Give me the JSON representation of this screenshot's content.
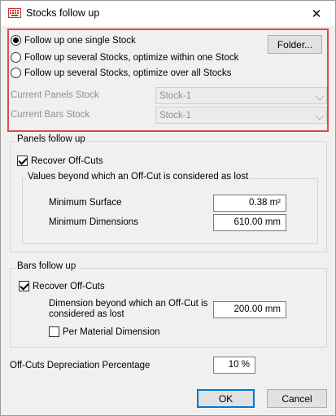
{
  "window": {
    "title": "Stocks follow up",
    "close_glyph": "✕",
    "app_icon": "keyboard-icon"
  },
  "mode": {
    "options": [
      {
        "label": "Follow up one single Stock",
        "checked": true
      },
      {
        "label": "Follow up several Stocks, optimize within one Stock",
        "checked": false
      },
      {
        "label": "Follow up several Stocks, optimize over all Stocks",
        "checked": false
      }
    ],
    "folder_button": "Folder..."
  },
  "stocks": {
    "panels_label": "Current Panels Stock",
    "panels_value": "Stock-1",
    "bars_label": "Current Bars Stock",
    "bars_value": "Stock-1"
  },
  "panels": {
    "group_title": "Panels follow up",
    "recover_label": "Recover Off-Cuts",
    "recover_checked": true,
    "inner_title": "Values beyond which an Off-Cut is considered as lost",
    "min_surface_label": "Minimum Surface",
    "min_surface_value": "0.38 m²",
    "min_dim_label": "Minimum Dimensions",
    "min_dim_value": "610.00 mm"
  },
  "bars": {
    "group_title": "Bars follow up",
    "recover_label": "Recover Off-Cuts",
    "recover_checked": true,
    "dimension_label_line1": "Dimension beyond which an Off-Cut is",
    "dimension_label_line2": "considered as lost",
    "dimension_value": "200.00 mm",
    "per_material_label": "Per Material Dimension",
    "per_material_checked": false
  },
  "depreciation": {
    "label": "Off-Cuts Depreciation Percentage",
    "value": "10 %"
  },
  "buttons": {
    "ok": "OK",
    "cancel": "Cancel"
  },
  "colors": {
    "highlight": "#e0474c",
    "default_button_border": "#0078d7"
  }
}
